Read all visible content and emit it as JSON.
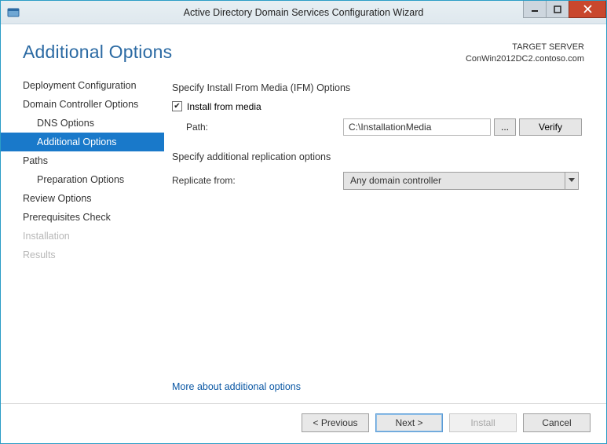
{
  "window": {
    "title": "Active Directory Domain Services Configuration Wizard"
  },
  "header": {
    "page_title": "Additional Options",
    "target_label": "TARGET SERVER",
    "target_value": "ConWin2012DC2.contoso.com"
  },
  "sidebar": {
    "items": [
      {
        "label": "Deployment Configuration",
        "child": false,
        "state": "normal"
      },
      {
        "label": "Domain Controller Options",
        "child": false,
        "state": "normal"
      },
      {
        "label": "DNS Options",
        "child": true,
        "state": "normal"
      },
      {
        "label": "Additional Options",
        "child": true,
        "state": "selected"
      },
      {
        "label": "Paths",
        "child": false,
        "state": "normal"
      },
      {
        "label": "Preparation Options",
        "child": true,
        "state": "normal"
      },
      {
        "label": "Review Options",
        "child": false,
        "state": "normal"
      },
      {
        "label": "Prerequisites Check",
        "child": false,
        "state": "normal"
      },
      {
        "label": "Installation",
        "child": false,
        "state": "disabled"
      },
      {
        "label": "Results",
        "child": false,
        "state": "disabled"
      }
    ]
  },
  "main": {
    "ifm_title": "Specify Install From Media (IFM) Options",
    "ifm_checkbox_label": "Install from media",
    "ifm_checked": true,
    "path_label": "Path:",
    "path_value": "C:\\InstallationMedia",
    "browse_label": "...",
    "verify_label": "Verify",
    "repl_title": "Specify additional replication options",
    "repl_label": "Replicate from:",
    "repl_value": "Any domain controller",
    "more_link": "More about additional options"
  },
  "footer": {
    "previous": "< Previous",
    "next": "Next >",
    "install": "Install",
    "cancel": "Cancel"
  }
}
